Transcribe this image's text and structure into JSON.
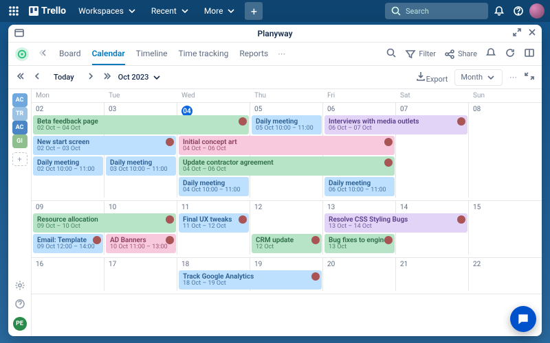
{
  "trelloBar": {
    "logo": "Trello",
    "menus": [
      "Workspaces",
      "Recent",
      "More"
    ],
    "searchPlaceholder": "Search"
  },
  "panel": {
    "title": "Planyway"
  },
  "tabs": {
    "items": [
      "Board",
      "Calendar",
      "Timeline",
      "Time tracking",
      "Reports"
    ],
    "activeIndex": 1,
    "filter": "Filter",
    "share": "Share"
  },
  "toolbar": {
    "today": "Today",
    "period": "Oct 2023",
    "export": "Export",
    "view": "Month"
  },
  "side": {
    "chips": [
      {
        "label": "AC",
        "color": "#6fa8dc"
      },
      {
        "label": "TR",
        "color": "#9cc3e4"
      },
      {
        "label": "AC",
        "color": "#4a86c5"
      },
      {
        "label": "GI",
        "color": "#8fbf8f"
      }
    ],
    "user": "PE"
  },
  "calendar": {
    "dayNames": [
      "Mon",
      "Tue",
      "Wed",
      "Thu",
      "Fri",
      "Sat",
      "Sun"
    ],
    "weeks": [
      {
        "nums": [
          "02",
          "03",
          "04",
          "05",
          "06",
          "07",
          "08"
        ],
        "todayCol": 2,
        "rows": 4,
        "events": [
          {
            "row": 0,
            "start": 0,
            "span": 3,
            "color": "green",
            "title": "Beta feedback page",
            "sub": "02 Oct – 04 Oct",
            "avatar": true
          },
          {
            "row": 0,
            "start": 3,
            "span": 1,
            "color": "blue",
            "title": "Daily meeting",
            "sub": "05 Oct 10:00 – 11:00"
          },
          {
            "row": 0,
            "start": 4,
            "span": 2,
            "color": "purple",
            "title": "Interviews with media outlets",
            "sub": "06 Oct – 07 Oct",
            "avatar": true
          },
          {
            "row": 1,
            "start": 0,
            "span": 2,
            "color": "blue",
            "title": "New start screen",
            "sub": "02 Oct – 03 Oct",
            "avatar": true
          },
          {
            "row": 1,
            "start": 2,
            "span": 3,
            "color": "pink",
            "title": "Initial concept art",
            "sub": "04 Oct – 06 Oct",
            "avatar": true
          },
          {
            "row": 2,
            "start": 0,
            "span": 1,
            "color": "blue",
            "title": "Daily meeting",
            "sub": "02 Oct 10:00 – 11:00"
          },
          {
            "row": 2,
            "start": 1,
            "span": 1,
            "color": "blue",
            "title": "Daily meeting",
            "sub": "03 Oct 10:00 – 11:00"
          },
          {
            "row": 2,
            "start": 2,
            "span": 3,
            "color": "green",
            "title": "Update contractor agreement",
            "sub": "04 Oct – 06 Oct",
            "avatar": true
          },
          {
            "row": 3,
            "start": 2,
            "span": 1,
            "color": "blue",
            "title": "Daily meeting",
            "sub": "04 Oct 10:00 – 11:00"
          },
          {
            "row": 3,
            "start": 4,
            "span": 1,
            "color": "blue",
            "title": "Daily meeting",
            "sub": "06 Oct 10:00 – 11:00"
          }
        ]
      },
      {
        "nums": [
          "09",
          "10",
          "11",
          "12",
          "13",
          "14",
          "15"
        ],
        "rows": 2,
        "events": [
          {
            "row": 0,
            "start": 0,
            "span": 2,
            "color": "green",
            "title": "Resource allocation",
            "sub": "09 Oct – 10 Oct",
            "avatar": true
          },
          {
            "row": 0,
            "start": 2,
            "span": 1,
            "color": "blue",
            "title": "Final UX tweaks",
            "sub": "11 Oct – 12 Oct",
            "avatar": true
          },
          {
            "row": 0,
            "start": 4,
            "span": 2,
            "color": "purple",
            "title": "Resolve CSS Styling Bugs",
            "sub": "13 Oct – 14 Oct",
            "avatar": true
          },
          {
            "row": 1,
            "start": 0,
            "span": 1,
            "color": "blue",
            "title": "Email: Template",
            "sub": "09 Oct 12:00 – 14:00",
            "avatar": true
          },
          {
            "row": 1,
            "start": 1,
            "span": 1,
            "color": "pink",
            "title": "AD Banners",
            "sub": "10 Oct 11:00 – 13:00",
            "avatar": true
          },
          {
            "row": 1,
            "start": 3,
            "span": 1,
            "color": "green",
            "title": "CRM update",
            "sub": "12 Oct",
            "avatar": true
          },
          {
            "row": 1,
            "start": 4,
            "span": 1,
            "color": "green",
            "title": "Bug fixes to engine",
            "sub": "13 Oct",
            "avatar": true
          }
        ]
      },
      {
        "nums": [
          "16",
          "17",
          "18",
          "19",
          "20",
          "21",
          "22"
        ],
        "rows": 1,
        "events": [
          {
            "row": 0,
            "start": 2,
            "span": 2,
            "color": "blue",
            "title": "Track Google Analytics",
            "sub": "18 Oct – 19 Oct",
            "avatar": true
          }
        ]
      }
    ]
  }
}
